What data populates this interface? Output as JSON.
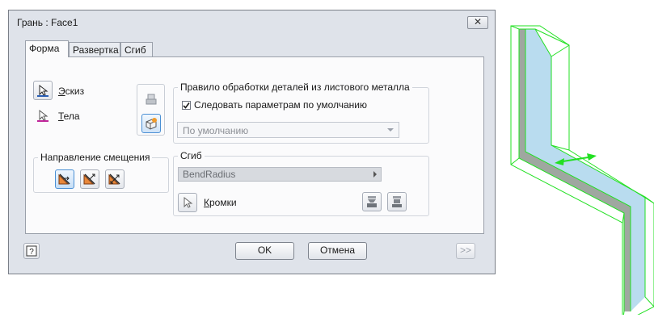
{
  "window": {
    "title": "Грань : Face1",
    "close_label": "✕"
  },
  "tabs": [
    {
      "label": "Форма",
      "active": true
    },
    {
      "label": "Развертка",
      "active": false
    },
    {
      "label": "Сгиб",
      "active": false
    }
  ],
  "shape": {
    "sketch": {
      "label_u": "Э",
      "label_rest": "скиз"
    },
    "bodies": {
      "label_u": "Т",
      "label_rest": "ела"
    }
  },
  "offset_direction": {
    "title": "Направление смещения"
  },
  "sheet_metal_rule": {
    "title": "Правило обработки деталей из листового металла",
    "follow_defaults_label": "Следовать параметрам по умолчанию",
    "follow_defaults_checked": true,
    "rule_value": "По умолчанию"
  },
  "bend": {
    "title": "Сгиб",
    "radius_value": "BendRadius",
    "edges": {
      "label_u": "К",
      "label_rest": "ромки"
    }
  },
  "footer": {
    "help_label": "?",
    "ok_label": "OK",
    "cancel_label": "Отмена",
    "more_label": ">>"
  },
  "colors": {
    "face_fill": "#b9dcef",
    "wire": "#22e022",
    "accent_arrow": "#e8873a"
  }
}
